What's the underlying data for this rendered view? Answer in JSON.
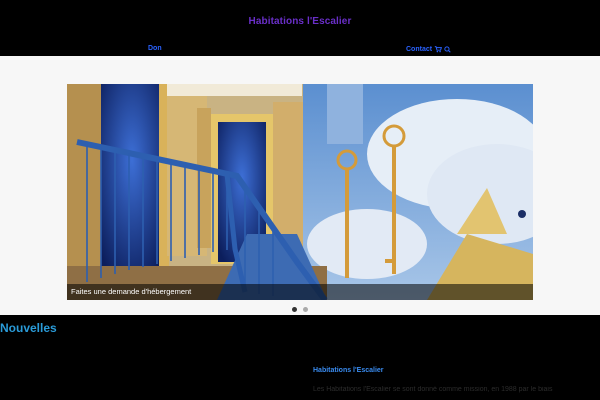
{
  "header": {
    "title": "Habitations l'Escalier",
    "nav": {
      "left_label": "Don",
      "right_label": "Contact",
      "cart_icon": "cart-icon",
      "search_icon": "search-icon"
    },
    "colors": {
      "title": "#6a2fc9",
      "nav": "#2a62ff"
    }
  },
  "carousel": {
    "caption": "Faites une demande d'hébergement",
    "dots": [
      {
        "active": true
      },
      {
        "active": false
      }
    ]
  },
  "main": {
    "heading": "Nouvelles",
    "aside_title": "Habitations l'Escalier",
    "aside_text": "Les Habitations l'Escalier se sont donné comme mission, en 1988 par le biais"
  }
}
